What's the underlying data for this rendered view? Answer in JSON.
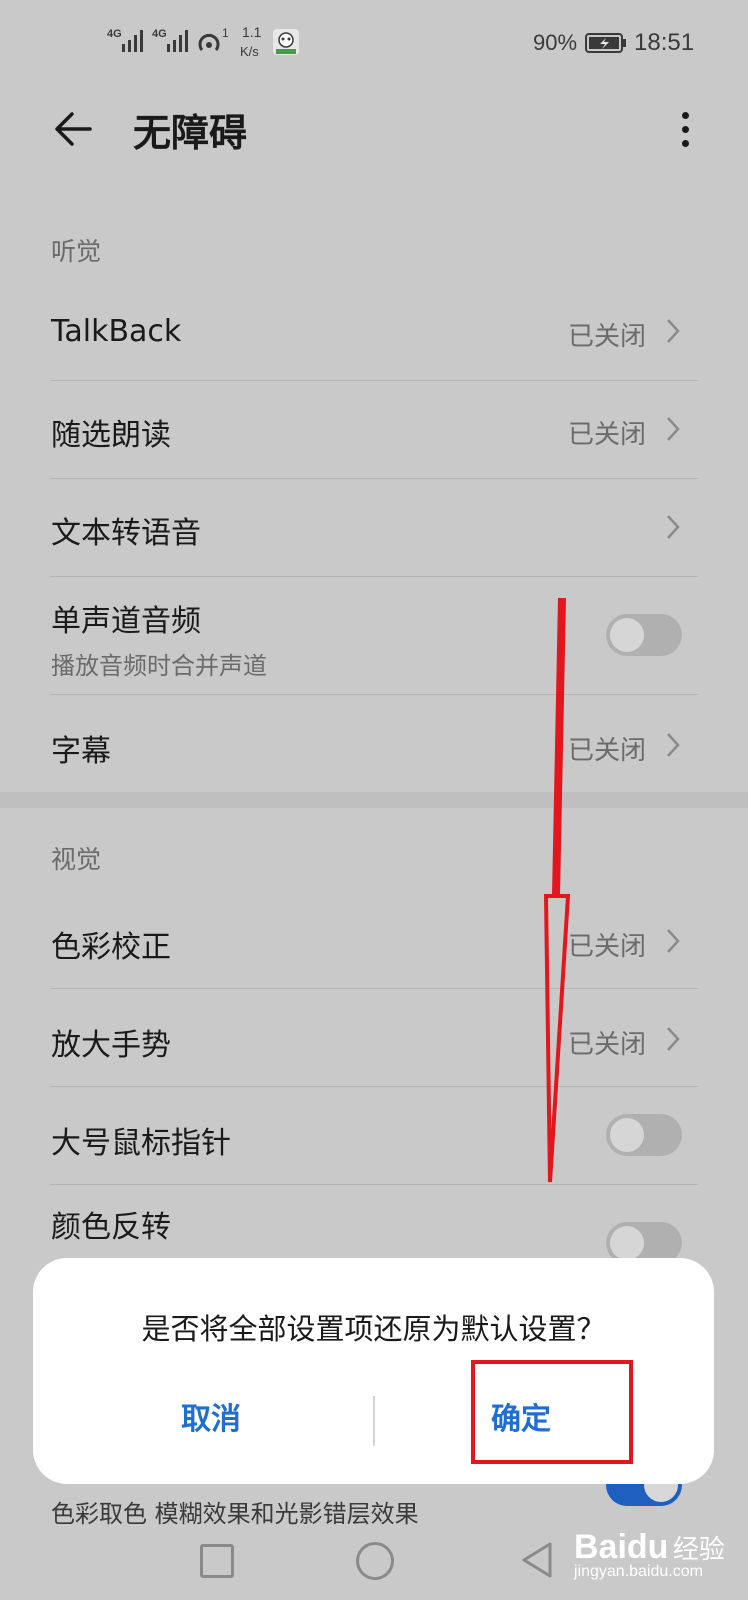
{
  "status_bar": {
    "net1": "4G",
    "net2": "4G",
    "hotspot_count": "1",
    "speed_value": "1.1",
    "speed_unit": "K/s",
    "battery": "90%",
    "time": "18:51"
  },
  "header": {
    "title": "无障碍"
  },
  "sections": {
    "hearing": {
      "label": "听觉",
      "talkback": {
        "title": "TalkBack",
        "status": "已关闭"
      },
      "select_to_speak": {
        "title": "随选朗读",
        "status": "已关闭"
      },
      "tts": {
        "title": "文本转语音"
      },
      "mono_audio": {
        "title": "单声道音频",
        "subtitle": "播放音频时合并声道",
        "enabled": false
      },
      "captions": {
        "title": "字幕",
        "status": "已关闭"
      }
    },
    "vision": {
      "label": "视觉",
      "color_correction": {
        "title": "色彩校正",
        "status": "已关闭"
      },
      "magnification": {
        "title": "放大手势",
        "status": "已关闭"
      },
      "large_pointer": {
        "title": "大号鼠标指针",
        "enabled": false
      },
      "color_inversion": {
        "title": "颜色反转",
        "enabled": false
      },
      "partial_row": {
        "text": "色彩取色  模糊效果和光影错层效果",
        "enabled": true
      }
    }
  },
  "dialog": {
    "message": "是否将全部设置项还原为默认设置？",
    "cancel_label": "取消",
    "confirm_label": "确定"
  },
  "colors": {
    "accent": "#1f6fd0",
    "annotation_red": "#e3151d",
    "scrim_background": "#c9c9c9"
  },
  "watermark": {
    "brand": "Baidu",
    "product": "经验",
    "url": "jingyan.baidu.com"
  }
}
